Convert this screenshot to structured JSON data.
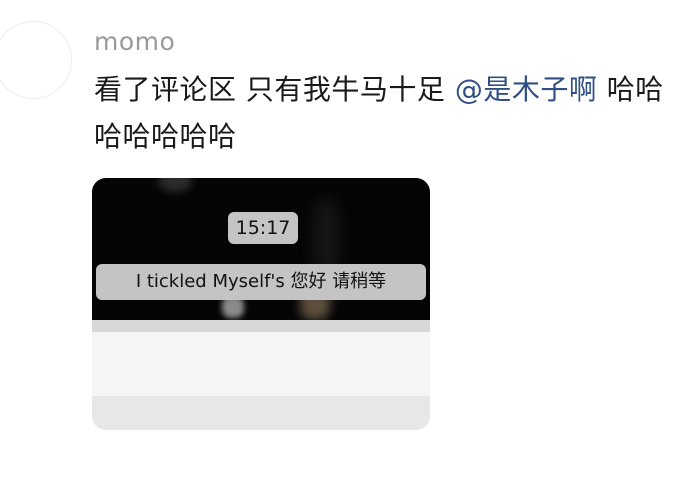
{
  "comment": {
    "username": "momo",
    "text_before": "看了评论区 只有我牛马十足 ",
    "mention": "@是木子啊",
    "text_after": " 哈哈哈哈哈哈哈"
  },
  "media": {
    "timestamp": "15:17",
    "notice": "I tickled Myself's 您好 请稍等"
  },
  "colors": {
    "mention": "#2f4f85",
    "username": "#9a9a9a",
    "text": "#1a1a1a",
    "pill": "#c4c4c4"
  }
}
